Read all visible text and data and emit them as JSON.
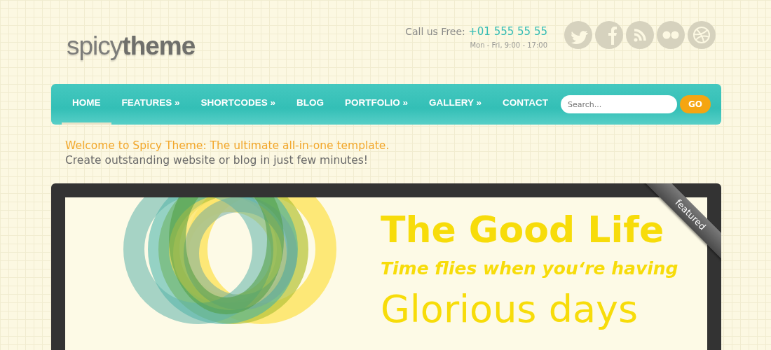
{
  "logo": {
    "light": "spicy",
    "bold": "theme"
  },
  "contact": {
    "label": "Call us Free:",
    "phone": "+01 555 55 55",
    "hours": "Mon - Fri, 9:00 - 17:00"
  },
  "social": [
    {
      "kind": "twitter"
    },
    {
      "kind": "facebook"
    },
    {
      "kind": "rss"
    },
    {
      "kind": "flickr"
    },
    {
      "kind": "dribbble"
    }
  ],
  "nav": [
    {
      "label": "HOME",
      "selected": true
    },
    {
      "label": "FEATURES »",
      "selected": false
    },
    {
      "label": "SHORTCODES »",
      "selected": false
    },
    {
      "label": "BLOG",
      "selected": false
    },
    {
      "label": "PORTFOLIO »",
      "selected": false
    },
    {
      "label": "GALLERY »",
      "selected": false
    },
    {
      "label": "CONTACT",
      "selected": false
    }
  ],
  "search": {
    "placeholder": "Search...",
    "button": "GO"
  },
  "intro": {
    "headline": "Welcome to Spicy Theme: The ultimate all-in-one template.",
    "subline": "Create outstanding website or blog in just few minutes!"
  },
  "slide": {
    "ribbon": "featured",
    "title": "The Good Life",
    "tagline": "Time flies when you‘re having",
    "subtitle": "Glorious days"
  }
}
